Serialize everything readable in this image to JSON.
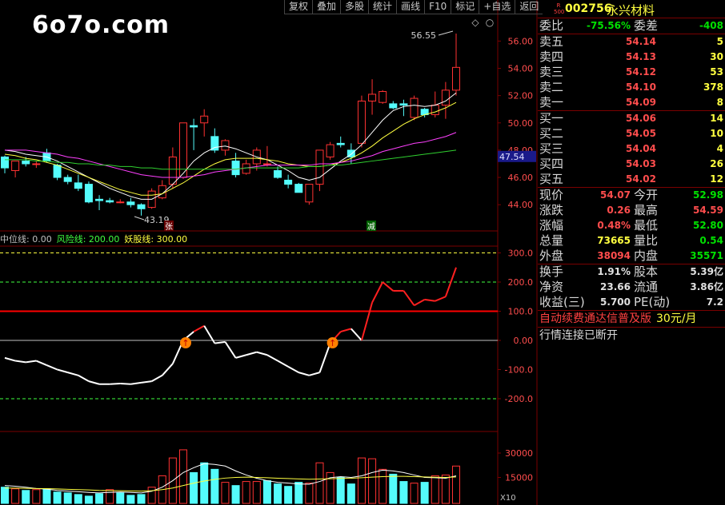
{
  "toolbar": {
    "buttons": [
      "复权",
      "叠加",
      "多股",
      "统计",
      "画线",
      "F10",
      "标记",
      "+自选",
      "返回"
    ]
  },
  "watermark": "6o7o.com",
  "chart_data": {
    "type": "candlestick",
    "price_axis": {
      "ticks": [
        56.0,
        54.0,
        52.0,
        50.0,
        48.0,
        46.0,
        44.0
      ],
      "current_tag": "47.54"
    },
    "annotations": {
      "high": "56.55",
      "low": "43.19",
      "flag_up": "张",
      "flag_down": "减"
    },
    "candles": [
      {
        "o": 47.5,
        "h": 47.6,
        "l": 46.3,
        "c": 46.7
      },
      {
        "o": 46.5,
        "h": 47.2,
        "l": 46.0,
        "c": 47.2
      },
      {
        "o": 47.2,
        "h": 47.5,
        "l": 46.8,
        "c": 47.0
      },
      {
        "o": 47.0,
        "h": 47.2,
        "l": 46.7,
        "c": 47.0
      },
      {
        "o": 47.8,
        "h": 48.1,
        "l": 47.1,
        "c": 47.2
      },
      {
        "o": 46.9,
        "h": 47.0,
        "l": 45.8,
        "c": 46.0
      },
      {
        "o": 46.0,
        "h": 46.2,
        "l": 45.5,
        "c": 45.7
      },
      {
        "o": 45.6,
        "h": 46.2,
        "l": 45.0,
        "c": 45.2
      },
      {
        "o": 45.5,
        "h": 45.7,
        "l": 44.1,
        "c": 44.2
      },
      {
        "o": 44.4,
        "h": 44.7,
        "l": 43.6,
        "c": 44.3
      },
      {
        "o": 44.3,
        "h": 44.5,
        "l": 44.1,
        "c": 44.2
      },
      {
        "o": 44.2,
        "h": 44.4,
        "l": 44.1,
        "c": 44.2
      },
      {
        "o": 44.2,
        "h": 44.5,
        "l": 43.8,
        "c": 44.0
      },
      {
        "o": 44.0,
        "h": 44.1,
        "l": 43.2,
        "c": 43.7
      },
      {
        "o": 43.8,
        "h": 45.2,
        "l": 43.7,
        "c": 45.0
      },
      {
        "o": 44.5,
        "h": 45.8,
        "l": 44.4,
        "c": 45.4
      },
      {
        "o": 45.5,
        "h": 48.2,
        "l": 45.2,
        "c": 47.5
      },
      {
        "o": 46.0,
        "h": 50.0,
        "l": 45.9,
        "c": 50.0
      },
      {
        "o": 49.8,
        "h": 50.3,
        "l": 48.0,
        "c": 49.7
      },
      {
        "o": 50.0,
        "h": 51.0,
        "l": 49.0,
        "c": 50.5
      },
      {
        "o": 49.0,
        "h": 49.6,
        "l": 47.8,
        "c": 48.0
      },
      {
        "o": 48.0,
        "h": 48.8,
        "l": 47.6,
        "c": 48.7
      },
      {
        "o": 47.2,
        "h": 47.8,
        "l": 46.0,
        "c": 46.2
      },
      {
        "o": 46.3,
        "h": 47.3,
        "l": 46.2,
        "c": 47.0
      },
      {
        "o": 47.0,
        "h": 48.2,
        "l": 46.5,
        "c": 48.0
      },
      {
        "o": 47.0,
        "h": 48.3,
        "l": 46.8,
        "c": 47.0
      },
      {
        "o": 46.5,
        "h": 46.8,
        "l": 45.9,
        "c": 46.0
      },
      {
        "o": 45.8,
        "h": 46.2,
        "l": 45.2,
        "c": 45.5
      },
      {
        "o": 45.5,
        "h": 45.6,
        "l": 44.9,
        "c": 44.9
      },
      {
        "o": 44.2,
        "h": 45.5,
        "l": 44.0,
        "c": 45.5
      },
      {
        "o": 45.5,
        "h": 48.0,
        "l": 45.0,
        "c": 48.0
      },
      {
        "o": 47.5,
        "h": 48.6,
        "l": 47.3,
        "c": 48.4
      },
      {
        "o": 48.5,
        "h": 49.0,
        "l": 48.2,
        "c": 48.4
      },
      {
        "o": 48.0,
        "h": 48.5,
        "l": 47.0,
        "c": 47.5
      },
      {
        "o": 48.5,
        "h": 52.0,
        "l": 48.2,
        "c": 51.6
      },
      {
        "o": 51.6,
        "h": 53.2,
        "l": 50.6,
        "c": 52.1
      },
      {
        "o": 51.5,
        "h": 52.4,
        "l": 51.4,
        "c": 52.3
      },
      {
        "o": 51.4,
        "h": 51.6,
        "l": 51.0,
        "c": 51.1
      },
      {
        "o": 51.4,
        "h": 51.7,
        "l": 50.5,
        "c": 51.3
      },
      {
        "o": 50.4,
        "h": 52.0,
        "l": 50.2,
        "c": 51.8
      },
      {
        "o": 51.0,
        "h": 51.1,
        "l": 50.4,
        "c": 50.6
      },
      {
        "o": 50.6,
        "h": 52.3,
        "l": 50.4,
        "c": 51.3
      },
      {
        "o": 51.3,
        "h": 53.0,
        "l": 50.3,
        "c": 52.4
      },
      {
        "o": 52.4,
        "h": 56.55,
        "l": 52.0,
        "c": 54.07
      }
    ],
    "ma_series": [
      {
        "color": "#ffffff",
        "values": [
          48.0,
          47.9,
          47.7,
          47.6,
          47.5,
          47.2,
          46.8,
          46.4,
          46.0,
          45.6,
          45.2,
          44.9,
          44.6,
          44.4,
          44.4,
          44.8,
          45.5,
          46.3,
          47.2,
          47.8,
          48.2,
          48.3,
          48.1,
          47.8,
          47.5,
          47.3,
          46.9,
          46.5,
          46.0,
          45.8,
          46.0,
          46.6,
          47.2,
          47.7,
          48.4,
          49.3,
          50.2,
          50.9,
          51.2,
          51.3,
          51.2,
          51.3,
          51.6,
          52.2
        ]
      },
      {
        "color": "#ffff40",
        "values": [
          47.7,
          47.6,
          47.4,
          47.3,
          47.1,
          46.9,
          46.6,
          46.3,
          46.0,
          45.7,
          45.4,
          45.1,
          44.9,
          44.7,
          44.7,
          44.8,
          45.2,
          45.6,
          46.1,
          46.6,
          47.0,
          47.3,
          47.4,
          47.4,
          47.4,
          47.3,
          47.2,
          47.0,
          46.9,
          46.8,
          46.8,
          46.9,
          47.1,
          47.4,
          47.8,
          48.3,
          48.9,
          49.4,
          49.9,
          50.3,
          50.6,
          50.8,
          51.1,
          51.5
        ]
      },
      {
        "color": "#ff40ff",
        "values": [
          48.0,
          48.0,
          48.0,
          47.9,
          47.8,
          47.7,
          47.5,
          47.4,
          47.2,
          47.0,
          46.8,
          46.6,
          46.4,
          46.2,
          46.1,
          46.0,
          46.0,
          46.0,
          46.1,
          46.2,
          46.4,
          46.5,
          46.6,
          46.7,
          46.8,
          46.9,
          46.9,
          46.9,
          46.9,
          46.9,
          47.0,
          47.0,
          47.1,
          47.2,
          47.4,
          47.6,
          47.9,
          48.1,
          48.3,
          48.5,
          48.6,
          48.8,
          49.0,
          49.3
        ]
      },
      {
        "color": "#30d030",
        "values": [
          47.3,
          47.3,
          47.3,
          47.2,
          47.2,
          47.1,
          47.1,
          47.0,
          47.0,
          46.9,
          46.9,
          46.8,
          46.8,
          46.7,
          46.7,
          46.6,
          46.6,
          46.6,
          46.6,
          46.6,
          46.6,
          46.6,
          46.6,
          46.7,
          46.7,
          46.7,
          46.7,
          46.7,
          46.7,
          46.8,
          46.8,
          46.9,
          46.9,
          47.0,
          47.1,
          47.2,
          47.3,
          47.4,
          47.5,
          47.6,
          47.7,
          47.8,
          47.9,
          48.0
        ]
      }
    ],
    "indicator": {
      "legend": [
        {
          "label": "中位线: 0.00",
          "color": "#c0c0c0"
        },
        {
          "label": "风险线: 200.00",
          "color": "#40ff40"
        },
        {
          "label": "妖股线: 300.00",
          "color": "#ffff40"
        }
      ],
      "ticks": [
        "300.0",
        "200.0",
        "100.0",
        "0.00",
        "-100.0",
        "-200.0"
      ],
      "values": [
        -60,
        -70,
        -75,
        -70,
        -85,
        -100,
        -110,
        -120,
        -140,
        -150,
        -150,
        -148,
        -150,
        -145,
        -140,
        -120,
        -80,
        0,
        30,
        50,
        -10,
        -5,
        -60,
        -50,
        -40,
        -50,
        -70,
        -90,
        -110,
        -120,
        -110,
        -10,
        30,
        40,
        0,
        130,
        200,
        170,
        170,
        120,
        140,
        135,
        150,
        250
      ],
      "markers": [
        "↑",
        "↑"
      ]
    },
    "volume": {
      "ticks": [
        "30000",
        "15000"
      ],
      "unit": "X10",
      "values": [
        9000,
        8000,
        7000,
        7500,
        8000,
        6000,
        5500,
        4500,
        3500,
        5000,
        7500,
        5500,
        4000,
        4500,
        9000,
        16000,
        27000,
        32000,
        18000,
        24000,
        20000,
        12000,
        10000,
        12500,
        12500,
        13000,
        11000,
        9500,
        12000,
        11500,
        24000,
        18000,
        15000,
        11000,
        27000,
        26500,
        20000,
        17000,
        12500,
        11500,
        12000,
        16000,
        16500,
        22000
      ],
      "up": [
        false,
        true,
        false,
        true,
        false,
        false,
        false,
        false,
        false,
        false,
        true,
        false,
        false,
        false,
        true,
        true,
        true,
        true,
        false,
        false,
        false,
        true,
        false,
        true,
        true,
        false,
        false,
        false,
        false,
        true,
        true,
        true,
        false,
        false,
        true,
        true,
        true,
        false,
        false,
        true,
        false,
        true,
        true,
        true
      ],
      "ma_white": [
        10000,
        9600,
        9000,
        8200,
        7800,
        7000,
        6600,
        6200,
        5800,
        5500,
        5800,
        6000,
        5800,
        5500,
        6500,
        9000,
        13000,
        18000,
        21000,
        23500,
        23000,
        22000,
        19000,
        16500,
        14500,
        13000,
        12000,
        11500,
        11000,
        10800,
        12500,
        14800,
        15500,
        15000,
        16000,
        18000,
        19500,
        19000,
        18000,
        16500,
        15000,
        14800,
        14500,
        16000
      ],
      "ma_yellow": [
        8500,
        8400,
        8300,
        8200,
        8100,
        7900,
        7700,
        7500,
        7300,
        7000,
        6900,
        6800,
        6700,
        6600,
        6800,
        7500,
        8500,
        10000,
        11500,
        12800,
        13800,
        14600,
        15000,
        15200,
        15000,
        14800,
        14500,
        14300,
        14100,
        13900,
        14000,
        14200,
        14400,
        14500,
        14800,
        15200,
        15500,
        15700,
        15700,
        15500,
        15300,
        15100,
        15000,
        15300
      ]
    }
  },
  "quote": {
    "code": "002756",
    "name": "永兴材料",
    "badge_top": "R",
    "badge_bottom": "500",
    "wei_bi_label": "委比",
    "wei_bi_value": "-75.56%",
    "wei_cha_label": "委差",
    "wei_cha_value": "-408",
    "sell": [
      {
        "label": "卖五",
        "price": "54.14",
        "vol": "5"
      },
      {
        "label": "卖四",
        "price": "54.13",
        "vol": "30"
      },
      {
        "label": "卖三",
        "price": "54.12",
        "vol": "53"
      },
      {
        "label": "卖二",
        "price": "54.10",
        "vol": "378"
      },
      {
        "label": "卖一",
        "price": "54.09",
        "vol": "8"
      }
    ],
    "buy": [
      {
        "label": "买一",
        "price": "54.06",
        "vol": "14"
      },
      {
        "label": "买二",
        "price": "54.05",
        "vol": "10"
      },
      {
        "label": "买三",
        "price": "54.04",
        "vol": "4"
      },
      {
        "label": "买四",
        "price": "54.03",
        "vol": "26"
      },
      {
        "label": "买五",
        "price": "54.02",
        "vol": "12"
      }
    ],
    "stats": [
      {
        "l1": "现价",
        "v1": "54.07",
        "c1": "r",
        "l2": "今开",
        "v2": "52.98",
        "c2": "g"
      },
      {
        "l1": "涨跌",
        "v1": "0.26",
        "c1": "r",
        "l2": "最高",
        "v2": "54.59",
        "c2": "r"
      },
      {
        "l1": "涨幅",
        "v1": "0.48%",
        "c1": "r",
        "l2": "最低",
        "v2": "52.80",
        "c2": "g"
      },
      {
        "l1": "总量",
        "v1": "73665",
        "c1": "y",
        "l2": "量比",
        "v2": "0.54",
        "c2": "g"
      },
      {
        "l1": "外盘",
        "v1": "38094",
        "c1": "r",
        "l2": "内盘",
        "v2": "35571",
        "c2": "g"
      }
    ],
    "stats2": [
      {
        "l1": "换手",
        "v1": "1.91%",
        "c1": "w",
        "l2": "股本",
        "v2": "5.39亿",
        "c2": "w"
      },
      {
        "l1": "净资",
        "v1": "23.66",
        "c1": "w",
        "l2": "流通",
        "v2": "3.86亿",
        "c2": "w"
      },
      {
        "l1": "收益(三)",
        "v1": "5.700",
        "c1": "w",
        "l2": "PE(动)",
        "v2": "7.2",
        "c2": "w"
      }
    ],
    "notice1": "自动续费通达信普及版",
    "notice1_price": "30元/月",
    "notice2": "行情连接已断开"
  },
  "colors": {
    "up": "#ff3232",
    "down": "#54fcfc",
    "grid": "#7a0000",
    "axis_text": "#ff4d4d"
  }
}
